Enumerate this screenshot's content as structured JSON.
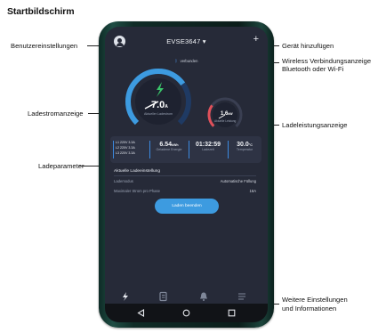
{
  "page": {
    "heading": "Startbildschirm"
  },
  "callouts": {
    "user_settings": "Benutzereinstellungen",
    "add_device": "Gerät hinzufügen",
    "wireless_line1": "Wireless Verbindungsanzeige",
    "wireless_line2": "Bluetooth oder Wi-Fi",
    "charging_current": "Ladestromanzeige",
    "charging_power": "Ladeleistungsanzeige",
    "charging_params": "Ladeparameter",
    "more_line1": "Weitere Einstellungen",
    "more_line2": "und Informationen"
  },
  "app": {
    "device_name": "EVSE3647 ▾",
    "add_symbol": "+",
    "connection_status": "verbunden",
    "current_gauge": {
      "value": "7.0",
      "unit": "A",
      "label": "Aktueller Ladestrom",
      "level": 0.72
    },
    "power_gauge": {
      "value": "1.6",
      "unit": "kW",
      "label": "Aktuelle Leistung",
      "level": 0.3
    },
    "phases": [
      "L1  220V  3.3A",
      "L2  220V  3.3A",
      "L3  220V  3.3A"
    ],
    "stats": [
      {
        "value": "6.54",
        "unit": "kWh",
        "label": "Geladene Energie"
      },
      {
        "value": "01:32:59",
        "unit": "",
        "label": "Ladezeit"
      },
      {
        "value": "30.0",
        "unit": "°C",
        "label": "Temperatur"
      }
    ],
    "params_title": "Aktuelle Ladeeinstellung",
    "params": [
      {
        "label": "Lademodus",
        "value": "Automatische Füllung"
      },
      {
        "label": "Maximaler Strom pro Phase",
        "value": "16A"
      }
    ],
    "stop_button": "Laden beenden"
  },
  "colors": {
    "accent": "#3d9be0",
    "power_arc": "#e0505a",
    "screen_bg": "#262a38",
    "charge_icon": "#3ac56a"
  }
}
